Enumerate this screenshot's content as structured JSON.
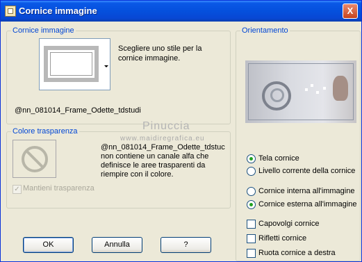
{
  "window": {
    "title": "Cornice immagine",
    "close_glyph": "X"
  },
  "frame_group": {
    "legend": "Cornice immagine",
    "thumbnail_icon": "frame-thumbnail-icon",
    "description": [
      "Scegliere uno stile per la",
      "cornice immagine."
    ],
    "filename": "@nn_081014_Frame_Odette_tdstudi"
  },
  "transparency_group": {
    "legend": "Colore trasparenza",
    "icon": "no-entry-icon",
    "message": [
      "@nn_081014_Frame_Odette_tdstuc",
      "non contiene un canale alfa che",
      "definisce le aree trasparenti da",
      "riempire con il colore."
    ],
    "maintain_label": "Mantieni trasparenza",
    "maintain_checked": true
  },
  "orientation_group": {
    "legend": "Orientamento",
    "radios_a": [
      {
        "label": "Tela cornice",
        "selected": true
      },
      {
        "label": "Livello corrente della cornice",
        "selected": false
      }
    ],
    "radios_b": [
      {
        "label": "Cornice interna all'immagine",
        "selected": false
      },
      {
        "label": "Cornice esterna all'immagine",
        "selected": true
      }
    ],
    "checkboxes": [
      {
        "label": "Capovolgi cornice",
        "checked": false
      },
      {
        "label": "Rifletti cornice",
        "checked": false
      },
      {
        "label": "Ruota cornice a destra",
        "checked": false
      }
    ]
  },
  "watermark": {
    "line1": "Pinuccia",
    "line2": "www.maidiregrafica.eu"
  },
  "buttons": {
    "ok": "OK",
    "cancel": "Annulla",
    "help": "?"
  },
  "colors": {
    "title_bar": "#0550dd",
    "legend": "#0046d5",
    "dialog_bg": "#ece9d8",
    "radio_dot": "#21a121"
  }
}
